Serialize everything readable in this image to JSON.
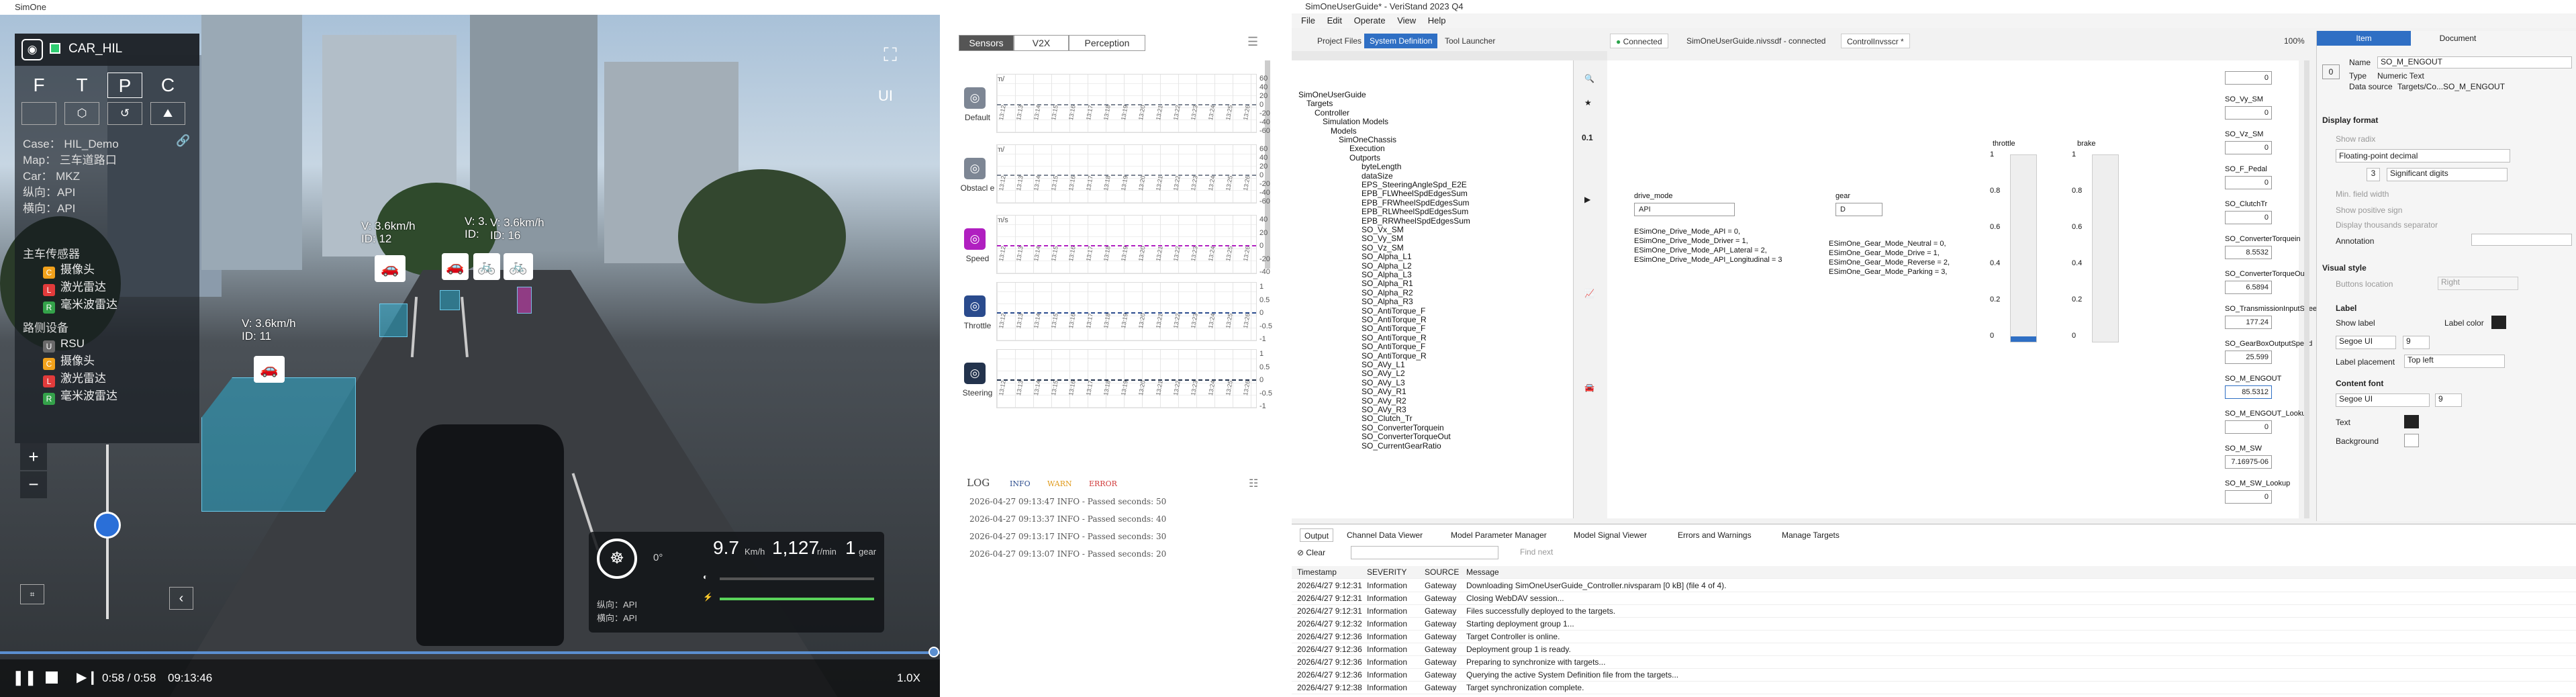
{
  "sim": {
    "window_title": "SimOne",
    "car_name": "CAR_HIL",
    "modes": [
      "F",
      "T",
      "P",
      "C"
    ],
    "case": "Case：   HIL_Demo",
    "map": "Map：  三车道路口",
    "car": "Car：   MKZ",
    "long_ctrl": "纵向：API",
    "lat_ctrl": "横向：API",
    "sensors_title": "主车传感器",
    "sensors": [
      {
        "badge": "C",
        "label": "摄像头",
        "color": "#f2a21b"
      },
      {
        "badge": "L",
        "label": "激光雷达",
        "color": "#e23b3b"
      },
      {
        "badge": "R",
        "label": "毫米波雷达",
        "color": "#34a24a"
      }
    ],
    "roadside_title": "路侧设备",
    "roadside": [
      {
        "badge": "U",
        "label": "RSU",
        "color": "#6a6a6a"
      },
      {
        "badge": "C",
        "label": "摄像头",
        "color": "#f2a21b"
      },
      {
        "badge": "L",
        "label": "激光雷达",
        "color": "#e23b3b"
      },
      {
        "badge": "R",
        "label": "毫米波雷达",
        "color": "#34a24a"
      }
    ],
    "vehicle_tags": [
      {
        "speed": "V: 3.6km/h",
        "id": "ID:  12"
      },
      {
        "speed": "V: 3.6km/h",
        "id": "ID:  11"
      },
      {
        "speed": "V: 3.6km/h",
        "id": "ID:  16"
      },
      {
        "speed": "V: 3.",
        "id": "ID:"
      }
    ],
    "ui_label": "UI",
    "steer_angle": "0°",
    "speed_value": "9.7",
    "speed_unit": "Km/h",
    "rpm_value": "1,127",
    "rpm_unit": "r/min",
    "gear_value": "1",
    "gear_unit": "gear",
    "dash_long": "纵向：API",
    "dash_lat": "横向：API",
    "time_pos": "0:58 / 0:58",
    "time_total": "09:13:46",
    "play_speed": "1.0X",
    "progress": 1.0
  },
  "charts": {
    "tabs": [
      "Sensors",
      "V2X",
      "Perception"
    ],
    "active_tab": "Sensors",
    "rows": [
      {
        "label": "Default",
        "icon": "default-icon",
        "color": "#7d8694",
        "axis": [
          "60",
          "40",
          "20",
          "0",
          "-20",
          "-40",
          "-60"
        ],
        "unit": "m/"
      },
      {
        "label": "Obstacl\ne",
        "icon": "obstacle-icon",
        "color": "#7d8694",
        "axis": [
          "60",
          "40",
          "20",
          "0",
          "-20",
          "-40",
          "-60"
        ],
        "unit": "m/"
      },
      {
        "label": "Speed",
        "icon": "speed-icon",
        "color": "#b01fc0",
        "axis": [
          "40",
          "20",
          "0",
          "-20",
          "-40"
        ],
        "unit": "m/s"
      },
      {
        "label": "Throttle",
        "icon": "throttle-icon",
        "color": "#2a4b8d",
        "axis": [
          "1",
          "0.5",
          "0",
          "-0.5",
          "-1"
        ],
        "unit": ""
      },
      {
        "label": "Steering",
        "icon": "steering-icon",
        "color": "#23334d",
        "axis": [
          "1",
          "0.5",
          "0",
          "-0.5",
          "-1"
        ],
        "unit": ""
      }
    ],
    "time_ticks": [
      "13:12",
      "13:13",
      "13:14",
      "13:15",
      "13:16",
      "13:17",
      "13:18",
      "13:19",
      "13:20",
      "13:21",
      "13:22",
      "13:23",
      "13:24",
      "13:25",
      "13:26"
    ],
    "log_title": "LOG",
    "log_filters": [
      "INFO",
      "WARN",
      "ERROR"
    ],
    "log_lines": [
      "2026-04-27 09:13:47 INFO - Passed seconds: 50",
      "2026-04-27 09:13:37 INFO - Passed seconds: 40",
      "2026-04-27 09:13:17 INFO - Passed seconds: 30",
      "2026-04-27 09:13:07 INFO - Passed seconds: 20"
    ]
  },
  "vs": {
    "window_title": "SimOneUserGuide* - VeriStand 2023 Q4",
    "menu": [
      "File",
      "Edit",
      "Operate",
      "View",
      "Help"
    ],
    "top_tabs": [
      "Project Files",
      "System Definition",
      "Tool Launcher"
    ],
    "doc_tabs": [
      "Connected",
      "SimOneUserGuide.nivssdf - connected",
      "ControlInvsscr *"
    ],
    "zoom": "100%",
    "tree": [
      "SimOneUserGuide",
      "Targets",
      "Controller",
      "Simulation Models",
      "Models",
      "SimOneChassis",
      "Execution",
      "Outports",
      "byteLength",
      "dataSize",
      "EPS_SteeringAngleSpd_E2E",
      "EPB_FLWheelSpdEdgesSum",
      "EPB_FRWheelSpdEdgesSum",
      "EPB_RLWheelSpdEdgesSum",
      "EPB_RRWheelSpdEdgesSum",
      "SO_Vx_SM",
      "SO_Vy_SM",
      "SO_Vz_SM",
      "SO_Alpha_L1",
      "SO_Alpha_L2",
      "SO_Alpha_L3",
      "SO_Alpha_R1",
      "SO_Alpha_R2",
      "SO_Alpha_R3",
      "SO_AntiTorque_F",
      "SO_AntiTorque_R",
      "SO_AntiTorque_F",
      "SO_AntiTorque_R",
      "SO_AntiTorque_F",
      "SO_AntiTorque_R",
      "SO_AVy_L1",
      "SO_AVy_L2",
      "SO_AVy_L3",
      "SO_AVy_R1",
      "SO_AVy_R2",
      "SO_AVy_R3",
      "SO_Clutch_Tr",
      "SO_ConverterTorquein",
      "SO_ConverterTorqueOut",
      "SO_CurrentGearRatio"
    ],
    "drive_mode_label": "drive_mode",
    "drive_mode_value": "API",
    "gear_label": "gear",
    "gear_value": "D",
    "drive_enums": [
      "ESimOne_Drive_Mode_API = 0,",
      "ESimOne_Drive_Mode_Driver = 1,",
      "ESimOne_Drive_Mode_API_Lateral = 2,",
      "ESimOne_Drive_Mode_API_Longitudinal = 3"
    ],
    "gear_enums": [
      "ESimOne_Gear_Mode_Neutral = 0,",
      "ESimOne_Gear_Mode_Drive = 1,",
      "ESimOne_Gear_Mode_Reverse = 2,",
      "ESimOne_Gear_Mode_Parking = 3,"
    ],
    "throttle_label": "throttle",
    "brake_label": "brake",
    "slider_ticks": [
      "1",
      "0.8",
      "0.6",
      "0.4",
      "0.2",
      "0"
    ],
    "throttle_level": 0.03,
    "brake_level": 0.0,
    "indicators": [
      {
        "label": "",
        "value": "0"
      },
      {
        "label": "SO_Vy_SM",
        "value": "0"
      },
      {
        "label": "SO_Vz_SM",
        "value": "0"
      },
      {
        "label": "SO_F_Pedal",
        "value": "0"
      },
      {
        "label": "SO_ClutchTr",
        "value": "0"
      },
      {
        "label": "SO_ConverterTorquein",
        "value": "8.5532"
      },
      {
        "label": "SO_ConverterTorqueOut",
        "value": "6.5894"
      },
      {
        "label": "SO_TransmissionInputSpeed",
        "value": "177.24"
      },
      {
        "label": "SO_GearBoxOutputSpeed",
        "value": "25.599"
      },
      {
        "label": "SO_M_ENGOUT",
        "value": "85.5312"
      },
      {
        "label": "SO_M_ENGOUT_Lookup",
        "value": "0"
      },
      {
        "label": "SO_M_SW",
        "value": "7.16975-06"
      },
      {
        "label": "SO_M_SW_Lookup",
        "value": "0"
      }
    ],
    "props_tabs": [
      "Item",
      "Document"
    ],
    "props": {
      "name_label": "Name",
      "name_value": "SO_M_ENGOUT",
      "type_label": "Type",
      "type_value": "Numeric Text",
      "source_label": "Data source",
      "source_value": "Targets/Co...SO_M_ENGOUT",
      "display_format": "Display format",
      "show_radix": "Show radix",
      "format_value": "Floating-point decimal",
      "digits": "3",
      "digits_type": "Significant digits",
      "min_field_width": "Min. field width",
      "show_plus": "Show positive sign",
      "show_sep": "Display thousands separator",
      "annotation": "Annotation",
      "visual_style": "Visual style",
      "buttons_location": "Buttons location",
      "buttons_value": "Right",
      "label_section": "Label",
      "show_label": "Show label",
      "label_color": "Label color",
      "font1": "Segoe UI",
      "size1": "9",
      "label_placement": "Label placement",
      "placement_value": "Top left",
      "content_font": "Content font",
      "font2": "Segoe UI",
      "size2": "9",
      "text_label": "Text",
      "background_label": "Background"
    },
    "output_tabs": [
      "Output",
      "Channel Data Viewer",
      "Model Parameter Manager",
      "Model Signal Viewer",
      "Errors and Warnings",
      "Manage Targets"
    ],
    "clear": "Clear",
    "find_next": "Find next",
    "cols": [
      "Timestamp",
      "SEVERITY",
      "SOURCE",
      "Message"
    ],
    "rows": [
      [
        "2026/4/27 9:12:31",
        "Information",
        "Gateway",
        "Downloading SimOneUserGuide_Controller.nivsparam [0 kB] (file 4 of 4)."
      ],
      [
        "2026/4/27 9:12:31",
        "Information",
        "Gateway",
        "Closing WebDAV session..."
      ],
      [
        "2026/4/27 9:12:31",
        "Information",
        "Gateway",
        "Files successfully deployed to the targets."
      ],
      [
        "2026/4/27 9:12:32",
        "Information",
        "Gateway",
        "Starting deployment group 1..."
      ],
      [
        "2026/4/27 9:12:36",
        "Information",
        "Gateway",
        "Target Controller is online."
      ],
      [
        "2026/4/27 9:12:36",
        "Information",
        "Gateway",
        "Deployment group 1 is ready."
      ],
      [
        "2026/4/27 9:12:36",
        "Information",
        "Gateway",
        "Preparing to synchronize with targets..."
      ],
      [
        "2026/4/27 9:12:36",
        "Information",
        "Gateway",
        "Querying the active System Definition file from the targets..."
      ],
      [
        "2026/4/27 9:12:38",
        "Information",
        "Gateway",
        "Target synchronization complete."
      ]
    ]
  }
}
